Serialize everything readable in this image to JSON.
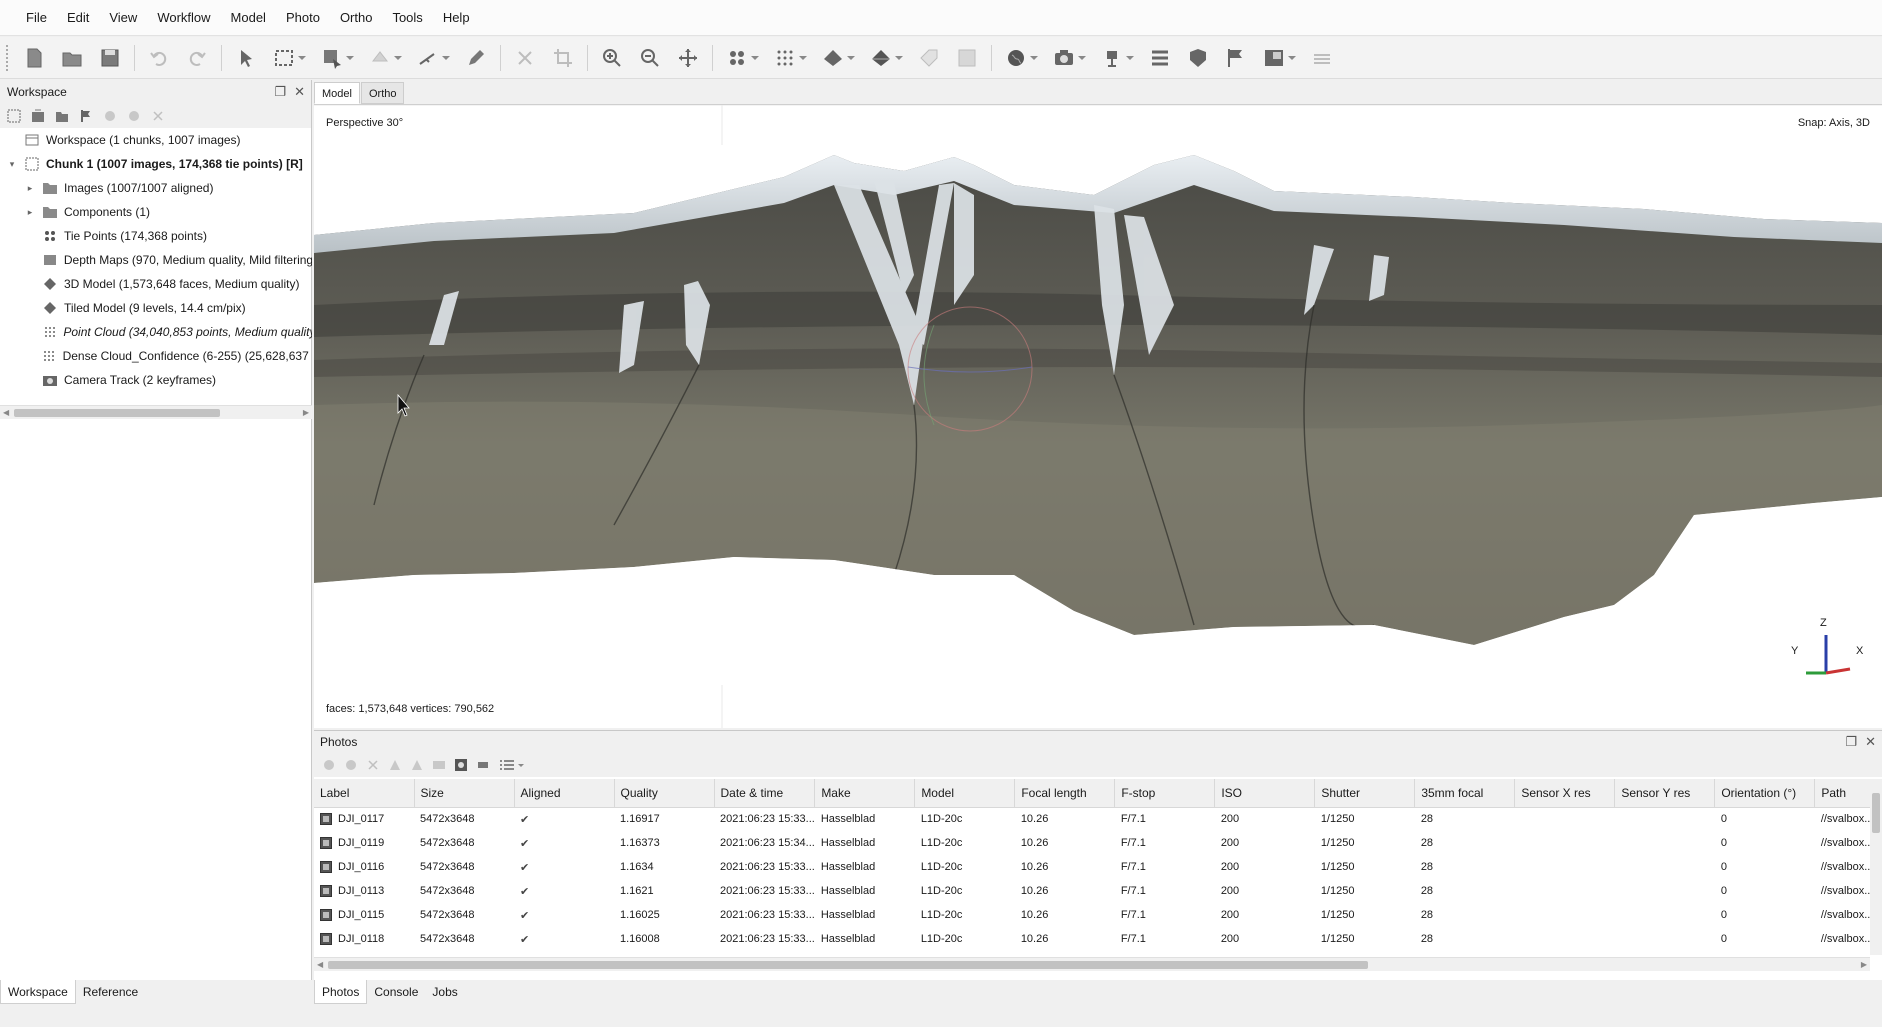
{
  "menu": [
    "File",
    "Edit",
    "View",
    "Workflow",
    "Model",
    "Photo",
    "Ortho",
    "Tools",
    "Help"
  ],
  "workspace": {
    "title": "Workspace",
    "tree": [
      {
        "label": "Workspace (1 chunks, 1007 images)",
        "indent": 0,
        "arrow": "",
        "icon": "workspace",
        "style": ""
      },
      {
        "label": "Chunk 1 (1007 images, 174,368 tie points) [R]",
        "indent": 1,
        "arrow": "down",
        "icon": "chunk",
        "style": "bold"
      },
      {
        "label": "Images (1007/1007 aligned)",
        "indent": 2,
        "arrow": "right",
        "icon": "folder",
        "style": ""
      },
      {
        "label": "Components (1)",
        "indent": 2,
        "arrow": "right",
        "icon": "folder",
        "style": ""
      },
      {
        "label": "Tie Points (174,368 points)",
        "indent": 2,
        "arrow": "",
        "icon": "points",
        "style": ""
      },
      {
        "label": "Depth Maps (970, Medium quality, Mild filtering",
        "indent": 2,
        "arrow": "",
        "icon": "depth",
        "style": ""
      },
      {
        "label": "3D Model (1,573,648 faces, Medium quality)",
        "indent": 2,
        "arrow": "",
        "icon": "model",
        "style": ""
      },
      {
        "label": "Tiled Model (9 levels, 14.4 cm/pix)",
        "indent": 2,
        "arrow": "",
        "icon": "model",
        "style": ""
      },
      {
        "label": "Point Cloud (34,040,853 points, Medium quality,",
        "indent": 2,
        "arrow": "",
        "icon": "dense",
        "style": "italic"
      },
      {
        "label": "Dense Cloud_Confidence (6-255) (25,628,637 po",
        "indent": 2,
        "arrow": "",
        "icon": "dense",
        "style": ""
      },
      {
        "label": "Camera Track (2 keyframes)",
        "indent": 2,
        "arrow": "",
        "icon": "camera",
        "style": ""
      }
    ],
    "tabs": [
      "Workspace",
      "Reference"
    ]
  },
  "viewport": {
    "tabs": [
      "Model",
      "Ortho"
    ],
    "projection": "Perspective 30°",
    "snap": "Snap: Axis, 3D",
    "stats": "faces: 1,573,648 vertices: 790,562",
    "axes": {
      "z": "Z",
      "y": "Y",
      "x": "X"
    }
  },
  "photos": {
    "title": "Photos",
    "columns": [
      "Label",
      "Size",
      "Aligned",
      "Quality",
      "Date & time",
      "Make",
      "Model",
      "Focal length",
      "F-stop",
      "ISO",
      "Shutter",
      "35mm focal",
      "Sensor X res",
      "Sensor Y res",
      "Orientation (°)",
      "Path"
    ],
    "rows": [
      [
        "DJI_0117",
        "5472x3648",
        "✔",
        "1.16917",
        "2021:06:23 15:33...",
        "Hasselblad",
        "L1D-20c",
        "10.26",
        "F/7.1",
        "200",
        "1/1250",
        "28",
        "",
        "",
        "0",
        "//svalbox..."
      ],
      [
        "DJI_0119",
        "5472x3648",
        "✔",
        "1.16373",
        "2021:06:23 15:34...",
        "Hasselblad",
        "L1D-20c",
        "10.26",
        "F/7.1",
        "200",
        "1/1250",
        "28",
        "",
        "",
        "0",
        "//svalbox..."
      ],
      [
        "DJI_0116",
        "5472x3648",
        "✔",
        "1.1634",
        "2021:06:23 15:33...",
        "Hasselblad",
        "L1D-20c",
        "10.26",
        "F/7.1",
        "200",
        "1/1250",
        "28",
        "",
        "",
        "0",
        "//svalbox..."
      ],
      [
        "DJI_0113",
        "5472x3648",
        "✔",
        "1.1621",
        "2021:06:23 15:33...",
        "Hasselblad",
        "L1D-20c",
        "10.26",
        "F/7.1",
        "200",
        "1/1250",
        "28",
        "",
        "",
        "0",
        "//svalbox..."
      ],
      [
        "DJI_0115",
        "5472x3648",
        "✔",
        "1.16025",
        "2021:06:23 15:33...",
        "Hasselblad",
        "L1D-20c",
        "10.26",
        "F/7.1",
        "200",
        "1/1250",
        "28",
        "",
        "",
        "0",
        "//svalbox..."
      ],
      [
        "DJI_0118",
        "5472x3648",
        "✔",
        "1.16008",
        "2021:06:23 15:33...",
        "Hasselblad",
        "L1D-20c",
        "10.26",
        "F/7.1",
        "200",
        "1/1250",
        "28",
        "",
        "",
        "0",
        "//svalbox..."
      ]
    ],
    "tabs": [
      "Photos",
      "Console",
      "Jobs"
    ]
  }
}
